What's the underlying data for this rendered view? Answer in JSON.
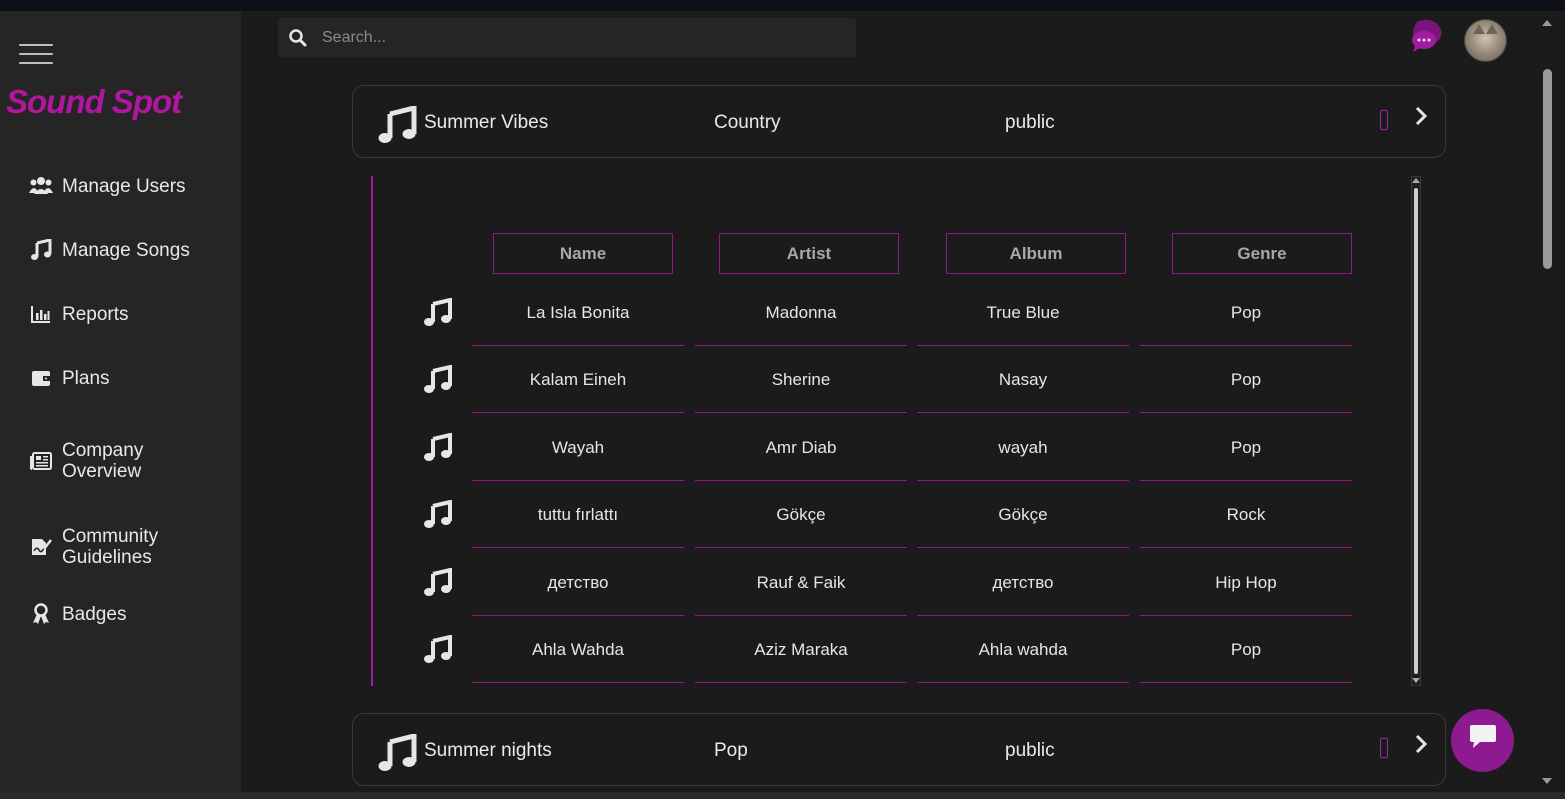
{
  "app": {
    "logo": "Sound Spot"
  },
  "sidebar": {
    "items": [
      {
        "label": "Manage Users",
        "icon": "users-icon"
      },
      {
        "label": "Manage Songs",
        "icon": "music-icon"
      },
      {
        "label": "Reports",
        "icon": "chart-icon"
      },
      {
        "label": "Plans",
        "icon": "wallet-icon"
      },
      {
        "label": "Company Overview",
        "icon": "newspaper-icon"
      },
      {
        "label": "Community Guidelines",
        "icon": "signature-icon"
      },
      {
        "label": "Badges",
        "icon": "award-icon"
      }
    ]
  },
  "search": {
    "placeholder": "Search..."
  },
  "colors": {
    "accent": "#a31aa3",
    "logo": "#b0179e",
    "background": "#1b1b1b",
    "sidebar": "#252525"
  },
  "playlists": [
    {
      "name": "Summer Vibes",
      "genre": "Country",
      "visibility": "public"
    },
    {
      "name": "Summer nights",
      "genre": "Pop",
      "visibility": "public"
    }
  ],
  "table": {
    "headers": [
      "Name",
      "Artist",
      "Album",
      "Genre"
    ],
    "rows": [
      {
        "name": "La Isla Bonita",
        "artist": "Madonna",
        "album": "True Blue",
        "genre": "Pop"
      },
      {
        "name": "Kalam Eineh",
        "artist": "Sherine",
        "album": "Nasay",
        "genre": "Pop"
      },
      {
        "name": "Wayah",
        "artist": "Amr Diab",
        "album": "wayah",
        "genre": "Pop"
      },
      {
        "name": "tuttu fırlattı",
        "artist": "Gökçe",
        "album": "Gökçe",
        "genre": "Rock"
      },
      {
        "name": "детство",
        "artist": "Rauf & Faik",
        "album": "детство",
        "genre": "Hip Hop"
      },
      {
        "name": "Ahla Wahda",
        "artist": "Aziz Maraka",
        "album": "Ahla wahda",
        "genre": "Pop"
      }
    ]
  }
}
